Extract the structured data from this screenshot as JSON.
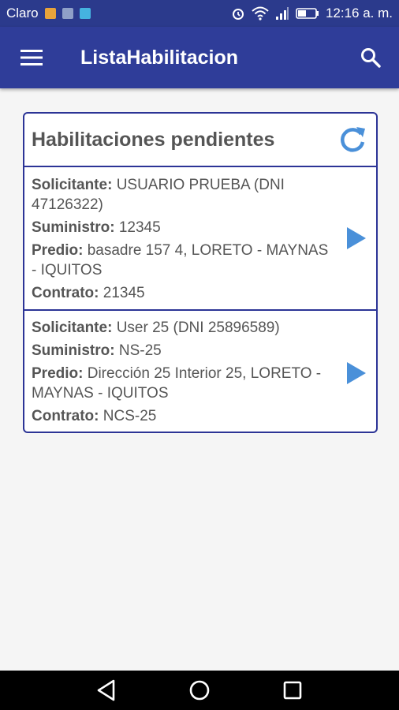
{
  "status_bar": {
    "carrier": "Claro",
    "time": "12:16 a. m."
  },
  "app_bar": {
    "title": "ListaHabilitacion"
  },
  "card": {
    "title": "Habilitaciones pendientes",
    "labels": {
      "solicitante": "Solicitante:",
      "suministro": "Suministro:",
      "predio": "Predio:",
      "contrato": "Contrato:"
    },
    "items": [
      {
        "solicitante": "USUARIO PRUEBA (DNI 47126322)",
        "suministro": "12345",
        "predio": "basadre 157 4, LORETO - MAYNAS - IQUITOS",
        "contrato": "21345"
      },
      {
        "solicitante": "User 25 (DNI 25896589)",
        "suministro": "NS-25",
        "predio": "Dirección 25 Interior 25, LORETO - MAYNAS - IQUITOS",
        "contrato": "NCS-25"
      }
    ]
  },
  "colors": {
    "primary": "#2f3d99",
    "accent": "#4a90d9",
    "card_border": "#2c3496"
  },
  "icons": [
    "menu-icon",
    "search-icon",
    "refresh-icon",
    "play-arrow-icon",
    "back-icon",
    "home-icon",
    "recents-icon"
  ]
}
